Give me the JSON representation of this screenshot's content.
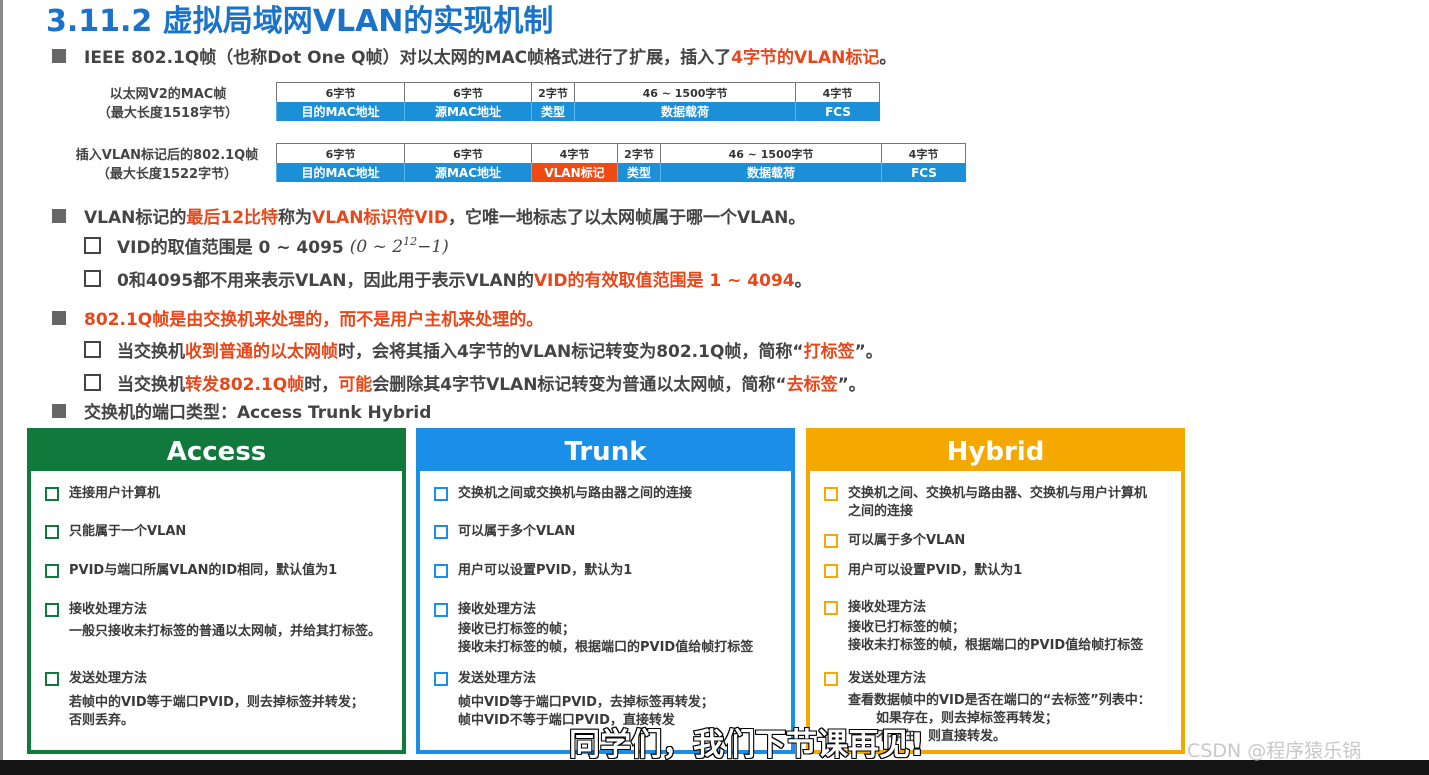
{
  "title": "3.11.2 虚拟局域网VLAN的实现机制",
  "bullets": {
    "b1_pre": "IEEE 802.1Q帧（也称Dot One Q帧）对以太网的MAC帧格式进行了扩展，插入了",
    "b1_hl": "4字节的VLAN标记",
    "b1_post": "。",
    "b2_pre": "VLAN标记的",
    "b2_hl1": "最后12比特",
    "b2_mid": "称为",
    "b2_hl2": "VLAN标识符VID",
    "b2_post": "，它唯一地标志了以太网帧属于哪一个VLAN。",
    "b2_c1_text": "VID的取值范围是 0 ~ 4095",
    "b2_c1_formula_pre": "(0 ~ 2",
    "b2_c1_formula_exp": "12",
    "b2_c1_formula_post": "−1)",
    "b2_c2_pre": "0和4095都不用来表示VLAN，因此用于表示VLAN的",
    "b2_c2_hl": "VID的有效取值范围是 1 ~ 4094",
    "b2_c2_post": "。",
    "b3": "802.1Q帧是由交换机来处理的，而不是用户主机来处理的。",
    "b3_c1_pre": "当交换机",
    "b3_c1_hl1": "收到普通的以太网帧",
    "b3_c1_mid": "时，会将其插入4字节的VLAN标记转变为802.1Q帧，简称“",
    "b3_c1_hl2": "打标签",
    "b3_c1_post": "”。",
    "b3_c2_pre": "当交换机",
    "b3_c2_hl1": "转发802.1Q帧",
    "b3_c2_mid1": "时，",
    "b3_c2_hl2": "可能",
    "b3_c2_mid2": "会删除其4字节VLAN标记转变为普通以太网帧，简称“",
    "b3_c2_hl3": "去标签",
    "b3_c2_post": "”。",
    "b4": "交换机的端口类型：Access  Trunk  Hybrid"
  },
  "frame1": {
    "label_line1": "以太网V2的MAC帧",
    "label_line2": "（最大长度1518字节）",
    "sizes": [
      "6字节",
      "6字节",
      "2字节",
      "46 ~ 1500字节",
      "4字节"
    ],
    "names": [
      "目的MAC地址",
      "源MAC地址",
      "类型",
      "数据载荷",
      "FCS"
    ]
  },
  "frame2": {
    "label_line1": "插入VLAN标记后的802.1Q帧",
    "label_line2": "（最大长度1522字节）",
    "sizes": [
      "6字节",
      "6字节",
      "4字节",
      "2字节",
      "46 ~ 1500字节",
      "4字节"
    ],
    "names": [
      "目的MAC地址",
      "源MAC地址",
      "VLAN标记",
      "类型",
      "数据载荷",
      "FCS"
    ]
  },
  "access": {
    "title": "Access",
    "i1": "连接用户计算机",
    "i2": "只能属于一个VLAN",
    "i3": "PVID与端口所属VLAN的ID相同，默认值为1",
    "i4": "接收处理方法",
    "i4_d1": "一般只接收未打标签的普通以太网帧，并给其打标签。",
    "i5": "发送处理方法",
    "i5_d1": "若帧中的VID等于端口PVID，则去掉标签并转发；",
    "i5_d2": "否则丢弃。"
  },
  "trunk": {
    "title": "Trunk",
    "i1": "交换机之间或交换机与路由器之间的连接",
    "i2": "可以属于多个VLAN",
    "i3": "用户可以设置PVID，默认为1",
    "i4": "接收处理方法",
    "i4_d1": "接收已打标签的帧；",
    "i4_d2": "接收未打标签的帧，根据端口的PVID值给帧打标签",
    "i5": "发送处理方法",
    "i5_d1": "帧中VID等于端口PVID，去掉标签再转发；",
    "i5_d2": "帧中VID不等于端口PVID，直接转发"
  },
  "hybrid": {
    "title": "Hybrid",
    "i1_l1": "交换机之间、交换机与路由器、交换机与用户计算机",
    "i1_l2": "之间的连接",
    "i2": "可以属于多个VLAN",
    "i3": "用户可以设置PVID，默认为1",
    "i4": "接收处理方法",
    "i4_d1": "接收已打标签的帧；",
    "i4_d2": "接收未打标签的帧，根据端口的PVID值给帧打标签",
    "i5": "发送处理方法",
    "i5_d1": "查看数据帧中的VID是否在端口的“去标签”列表中：",
    "i5_d2": "如果存在，则去掉标签再转发；",
    "i5_d3": "不存在，则直接转发。"
  },
  "overlay": {
    "subtitle": "同学们，我们下节课再见!",
    "watermark": "CSDN @程序猿乐锅"
  }
}
